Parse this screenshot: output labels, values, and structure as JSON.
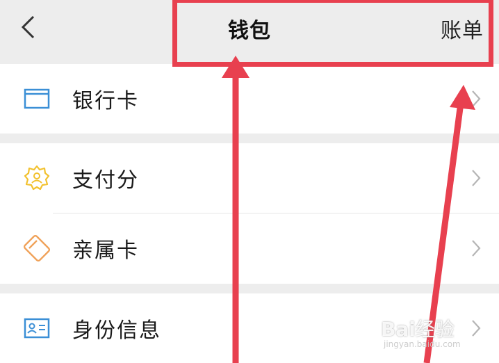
{
  "header": {
    "title": "钱包",
    "bill_label": "账单"
  },
  "menu": {
    "bank_card": "银行卡",
    "pay_score": "支付分",
    "family_card": "亲属卡",
    "identity_info": "身份信息"
  },
  "watermark": {
    "brand": "Bai",
    "brand_sub": "经验",
    "url": "jingyan.baidu.com"
  },
  "colors": {
    "accent_blue": "#3b8fd6",
    "pay_score_yellow": "#f2c12e",
    "family_card_orange": "#f0a25a",
    "annotation_red": "#e8404f"
  },
  "icons": {
    "back": "chevron-left-icon",
    "bank_card": "bank-card-icon",
    "pay_score": "pay-score-badge-icon",
    "family_card": "family-card-icon",
    "identity_info": "id-card-icon",
    "row_chevron": "chevron-right-icon"
  }
}
